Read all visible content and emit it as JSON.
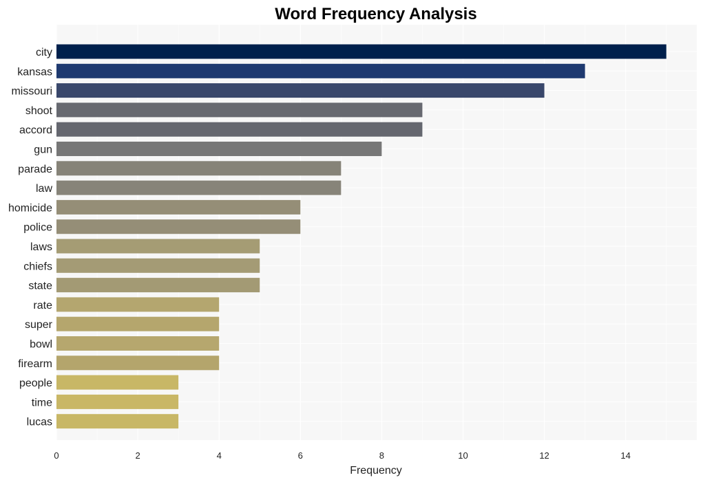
{
  "chart_data": {
    "type": "bar",
    "orientation": "horizontal",
    "title": "Word Frequency Analysis",
    "xlabel": "Frequency",
    "ylabel": "",
    "xlim": [
      0,
      15.75
    ],
    "xticks": [
      0,
      2,
      4,
      6,
      8,
      10,
      12,
      14
    ],
    "grid": true,
    "legend": "none",
    "categories": [
      "city",
      "kansas",
      "missouri",
      "shoot",
      "accord",
      "gun",
      "parade",
      "law",
      "homicide",
      "police",
      "laws",
      "chiefs",
      "state",
      "rate",
      "super",
      "bowl",
      "firearm",
      "people",
      "time",
      "lucas"
    ],
    "values": [
      15,
      13,
      12,
      9,
      9,
      8,
      7,
      7,
      6,
      6,
      5,
      5,
      5,
      4,
      4,
      4,
      4,
      3,
      3,
      3
    ],
    "colors": [
      "#00204c",
      "#1f3a70",
      "#39476b",
      "#676970",
      "#65676f",
      "#777777",
      "#868378",
      "#878479",
      "#958e77",
      "#958e77",
      "#a59c74",
      "#a49b75",
      "#a39a74",
      "#b4a66f",
      "#b5a66d",
      "#b6a76e",
      "#b4a56c",
      "#c8b766",
      "#c9b766",
      "#c8b766"
    ],
    "background": "#f7f7f7"
  }
}
